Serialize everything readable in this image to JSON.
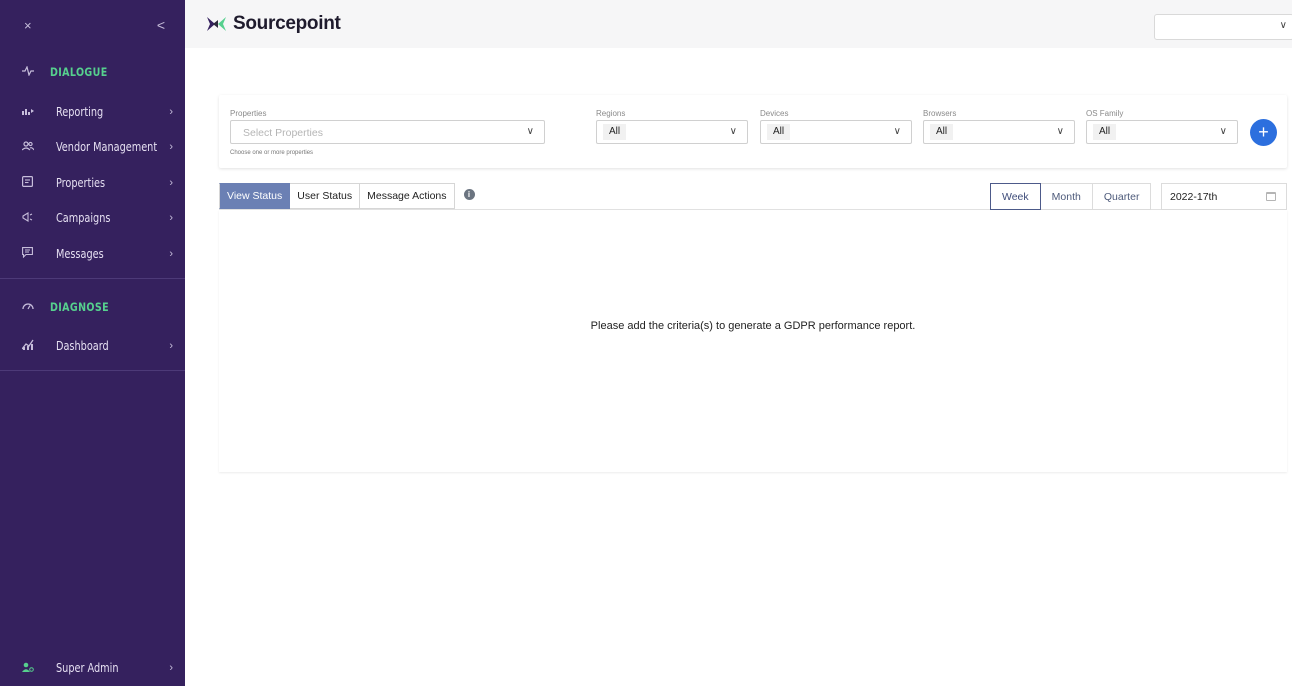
{
  "sidebar": {
    "close_label": "×",
    "collapse_label": "<",
    "sections": [
      {
        "title": "DIALOGUE",
        "icon": "pulse-icon",
        "items": [
          {
            "label": "Reporting",
            "icon": "chart-icon"
          },
          {
            "label": "Vendor Management",
            "icon": "users-icon"
          },
          {
            "label": "Properties",
            "icon": "document-icon"
          },
          {
            "label": "Campaigns",
            "icon": "megaphone-icon"
          },
          {
            "label": "Messages",
            "icon": "message-icon"
          }
        ]
      },
      {
        "title": "DIAGNOSE",
        "icon": "gauge-icon",
        "items": [
          {
            "label": "Dashboard",
            "icon": "analytics-icon"
          }
        ]
      }
    ],
    "footer": {
      "label": "Super Admin",
      "icon": "admin-user-icon"
    }
  },
  "header": {
    "logo_text": "Sourcepoint",
    "account_select_value": ""
  },
  "filters": {
    "properties": {
      "label": "Properties",
      "placeholder": "Select Properties",
      "help": "Choose one or more properties"
    },
    "regions": {
      "label": "Regions",
      "value": "All"
    },
    "devices": {
      "label": "Devices",
      "value": "All"
    },
    "browsers": {
      "label": "Browsers",
      "value": "All"
    },
    "os_family": {
      "label": "OS Family",
      "value": "All"
    },
    "add_label": "+"
  },
  "tabs": [
    "View Status",
    "User Status",
    "Message Actions"
  ],
  "active_tab": "View Status",
  "periods": [
    "Week",
    "Month",
    "Quarter"
  ],
  "active_period": "Week",
  "date_value": "2022-17th",
  "empty_message": "Please add the criteria(s) to generate a GDPR performance report.",
  "colors": {
    "sidebar_bg": "#35215e",
    "section_title": "#56d08e",
    "active_tab": "#6b80b4",
    "add_button": "#2c6fde"
  }
}
